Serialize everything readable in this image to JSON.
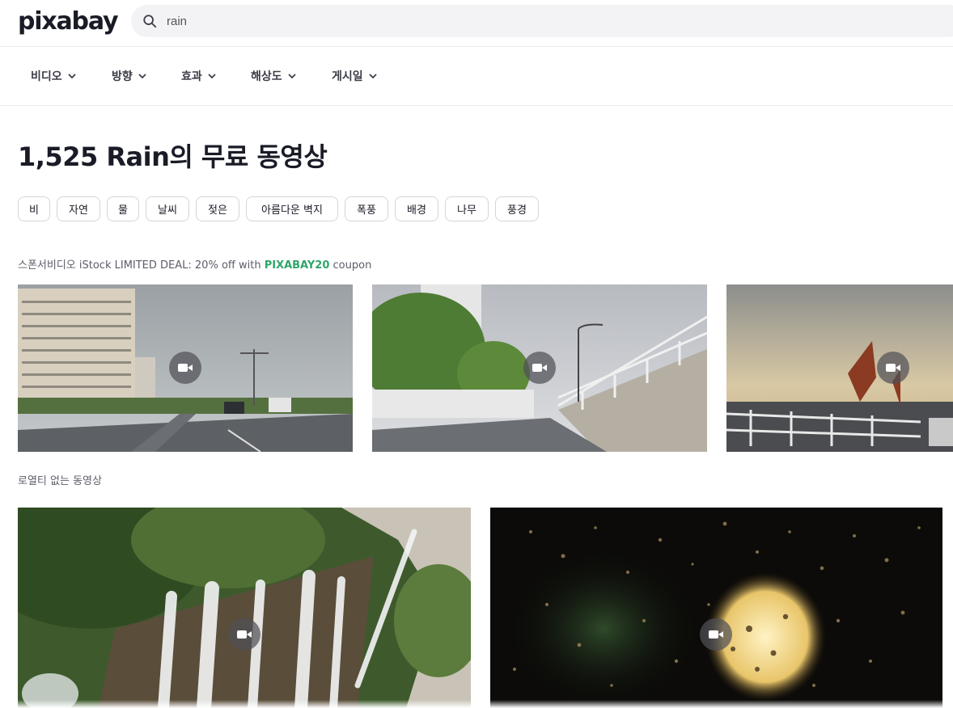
{
  "header": {
    "logo_text": "pixabay",
    "search": {
      "value": "rain",
      "icon": "search-icon"
    }
  },
  "filters": [
    {
      "label": "비디오",
      "icon": "chevron-down-icon"
    },
    {
      "label": "방향",
      "icon": "chevron-down-icon"
    },
    {
      "label": "효과",
      "icon": "chevron-down-icon"
    },
    {
      "label": "해상도",
      "icon": "chevron-down-icon"
    },
    {
      "label": "게시일",
      "icon": "chevron-down-icon"
    }
  ],
  "page_title": "1,525 Rain의 무료 동영상",
  "tags": [
    "비",
    "자연",
    "물",
    "날씨",
    "젖은",
    "아름다운 벽지",
    "폭풍",
    "배경",
    "나무",
    "풍경"
  ],
  "sponsored": {
    "prefix": "스폰서비디오 iStock LIMITED DEAL: 20% off with ",
    "coupon": "PIXABAY20",
    "suffix": " coupon"
  },
  "sponsored_videos": [
    {
      "subject": "highway-buildings",
      "icon": "video-camera-icon"
    },
    {
      "subject": "road-railing-trees",
      "icon": "video-camera-icon"
    },
    {
      "subject": "sunset-flags-bridge",
      "icon": "video-camera-icon"
    }
  ],
  "royalty_free_label": "로열티 없는 동영상",
  "videos": [
    {
      "subject": "waterfall-aerial",
      "icon": "video-camera-icon"
    },
    {
      "subject": "raindrops-window-light",
      "icon": "video-camera-icon"
    }
  ],
  "colors": {
    "accent_green": "#2ea66b",
    "text_dark": "#191b26",
    "text_muted": "#5c5d68",
    "border": "#d5d5dc"
  }
}
